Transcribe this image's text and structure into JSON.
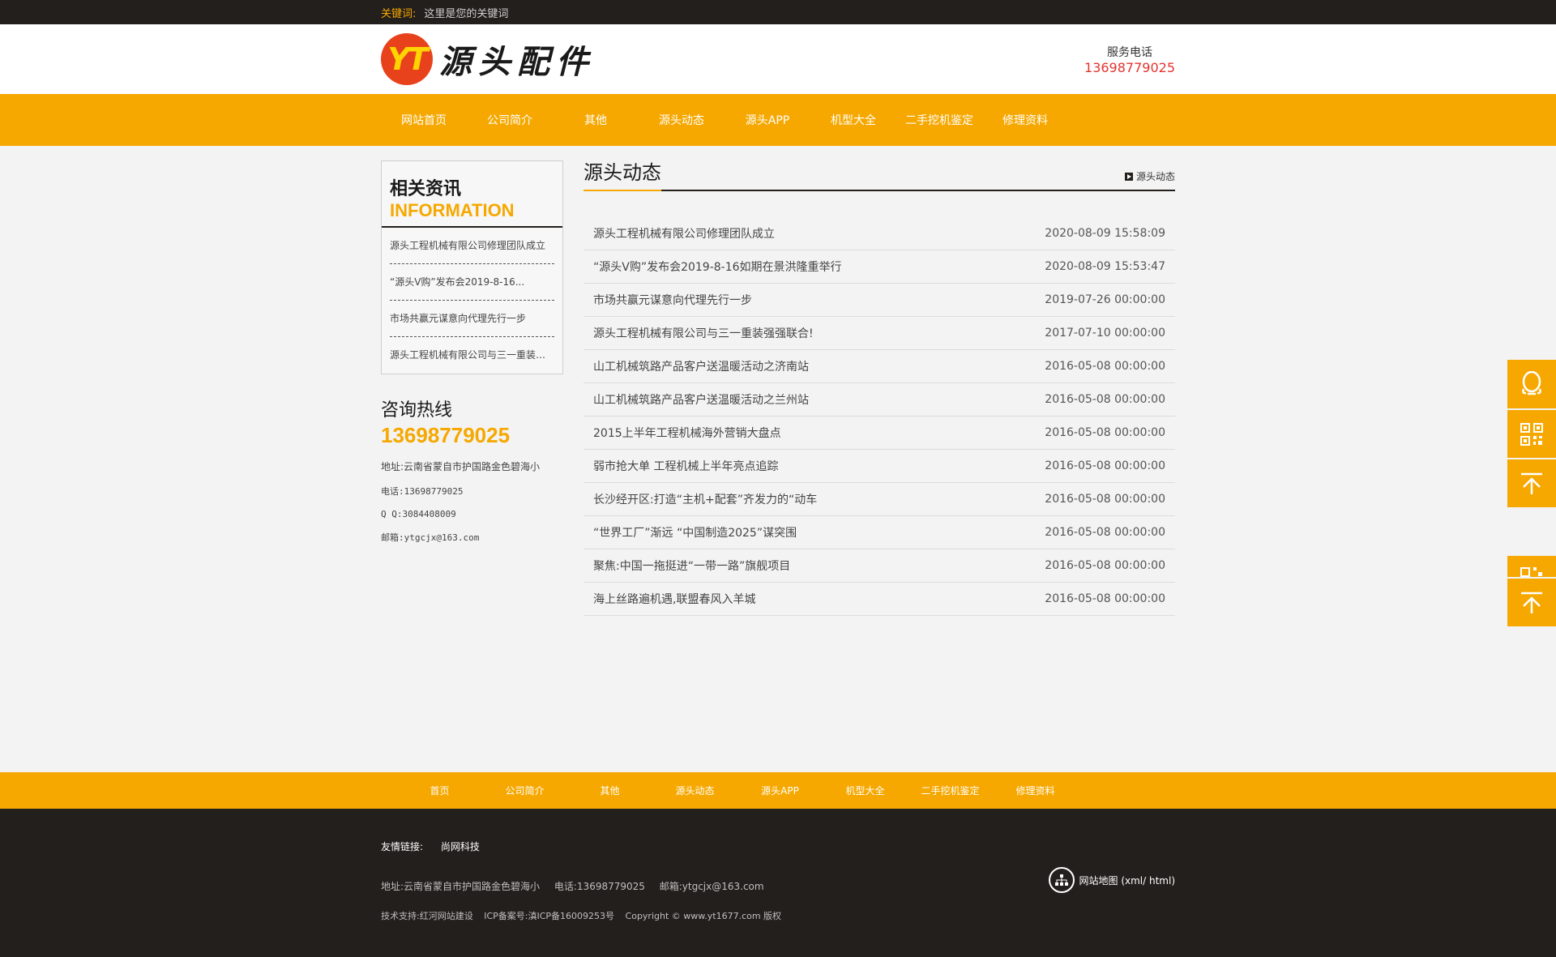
{
  "topbar": {
    "keyword_label": "关键词:",
    "keyword_text": "这里是您的关键词"
  },
  "header": {
    "logo_badge": "YT",
    "logo_text": "源头配件",
    "hotline_label": "服务电话",
    "hotline_number": "13698779025"
  },
  "nav": [
    "网站首页",
    "公司简介",
    "其他",
    "源头动态",
    "源头APP",
    "机型大全",
    "二手挖机鉴定",
    "修理资料"
  ],
  "sidebar": {
    "info_title": "相关资讯",
    "info_sub": "INFORMATION",
    "info_items": [
      "源头工程机械有限公司修理团队成立",
      "“源头V购”发布会2019-8-16...",
      "市场共赢元谋意向代理先行一步",
      "源头工程机械有限公司与三一重装…"
    ],
    "contact_title": "咨询热线",
    "contact_number": "13698779025",
    "address": "地址:云南省蒙自市护国路金色碧海小",
    "phone": "电话:13698779025",
    "qq": "Q Q:3084408009",
    "email": "邮箱:ytgcjx@163.com"
  },
  "content": {
    "title": "源头动态",
    "breadcrumb": "源头动态",
    "news": [
      {
        "title": "源头工程机械有限公司修理团队成立",
        "date": "2020-08-09 15:58:09"
      },
      {
        "title": "“源头V购”发布会2019-8-16如期在景洪隆重举行",
        "date": "2020-08-09 15:53:47"
      },
      {
        "title": "市场共赢元谋意向代理先行一步",
        "date": "2019-07-26 00:00:00"
      },
      {
        "title": "源头工程机械有限公司与三一重装强强联合!",
        "date": "2017-07-10 00:00:00"
      },
      {
        "title": "山工机械筑路产品客户送温暖活动之济南站",
        "date": "2016-05-08 00:00:00"
      },
      {
        "title": "山工机械筑路产品客户送温暖活动之兰州站",
        "date": "2016-05-08 00:00:00"
      },
      {
        "title": "2015上半年工程机械海外营销大盘点",
        "date": "2016-05-08 00:00:00"
      },
      {
        "title": "弱市抢大单 工程机械上半年亮点追踪",
        "date": "2016-05-08 00:00:00"
      },
      {
        "title": "长沙经开区:打造“主机+配套”齐发力的“动车",
        "date": "2016-05-08 00:00:00"
      },
      {
        "title": "“世界工厂”渐远 “中国制造2025”谋突围",
        "date": "2016-05-08 00:00:00"
      },
      {
        "title": "聚焦:中国一拖挺进“一带一路”旗舰项目",
        "date": "2016-05-08 00:00:00"
      },
      {
        "title": "海上丝路遍机遇,联盟春风入羊城",
        "date": "2016-05-08 00:00:00"
      }
    ]
  },
  "footer_nav": [
    "首页",
    "公司简介",
    "其他",
    "源头动态",
    "源头APP",
    "机型大全",
    "二手挖机鉴定",
    "修理资料"
  ],
  "footer": {
    "links_label": "友情链接:",
    "links": [
      "尚网科技"
    ],
    "address": "地址:云南省蒙自市护国路金色碧海小",
    "phone": "电话:13698779025",
    "email": "邮箱:ytgcjx@163.com",
    "tech": "技术支持:红河网站建设",
    "icp": "ICP备案号:滇ICP备16009253号",
    "copyright": "Copyright © www.yt1677.com 版权",
    "sitemap": "网站地图 (xml/ html)"
  },
  "float_icons": [
    "qq-icon",
    "qrcode-icon",
    "back-to-top-icon",
    "qrcode-icon",
    "back-to-top-icon"
  ],
  "colors": {
    "accent": "#f6a800",
    "dark": "#231f1c",
    "hotline": "#e3342f"
  }
}
